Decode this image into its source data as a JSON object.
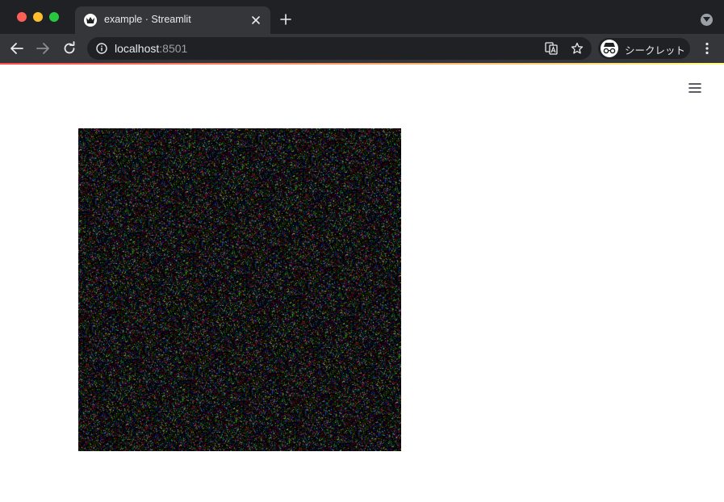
{
  "browser": {
    "tab": {
      "title": "example · Streamlit"
    },
    "address": {
      "host": "localhost",
      "port": ":8501"
    },
    "profile": {
      "label": "シークレット"
    }
  },
  "colors": {
    "chrome_dark": "#202124",
    "chrome_toolbar": "#35363a",
    "streamlit_accent": "#ff4b4b",
    "streamlit_accent_end": "#fffd80"
  },
  "icons": {
    "tab_favicon": "streamlit-crown-icon",
    "tab_close": "close-icon",
    "new_tab": "plus-icon",
    "tab_search": "chevron-down-icon",
    "back": "arrow-left-icon",
    "forward": "arrow-right-icon",
    "reload": "reload-icon",
    "site_info": "info-icon",
    "translate": "translate-icon",
    "bookmark": "star-icon",
    "incognito": "incognito-icon",
    "browser_menu": "kebab-menu-icon",
    "app_menu": "hamburger-icon"
  },
  "app": {
    "image": {
      "content": "random RGB noise"
    }
  }
}
